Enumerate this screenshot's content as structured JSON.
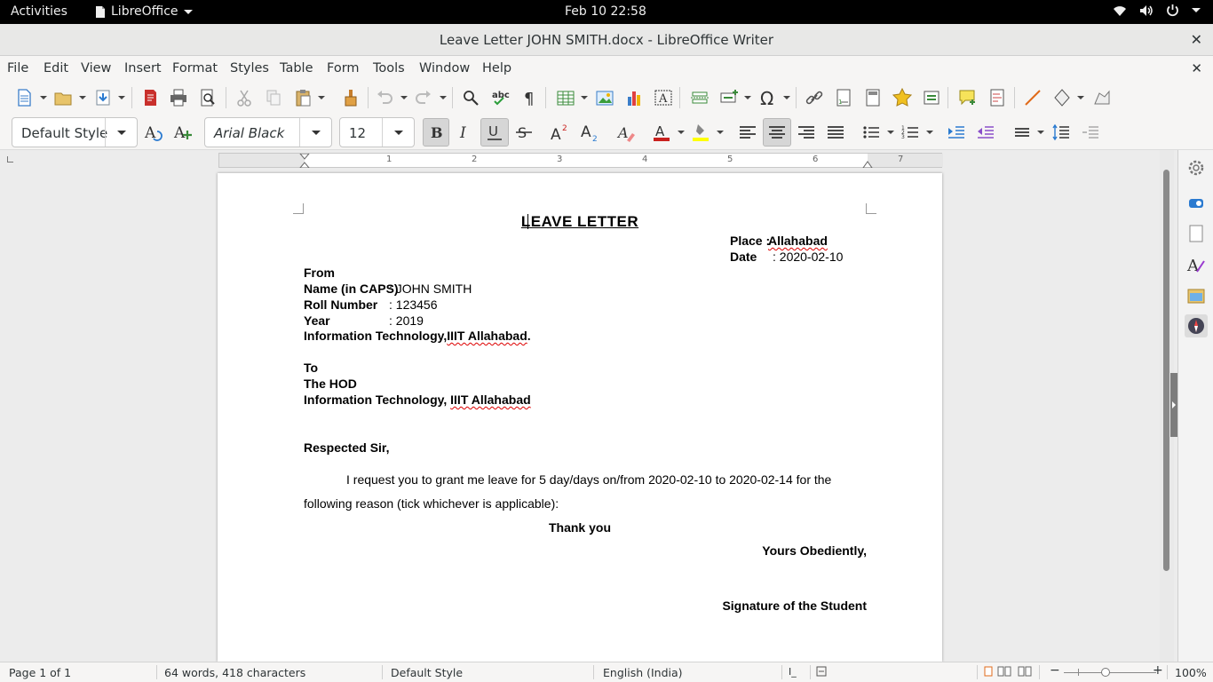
{
  "topbar": {
    "activities": "Activities",
    "app_name": "LibreOffice",
    "clock": "Feb 10  22:58"
  },
  "window": {
    "title": "Leave Letter JOHN SMITH.docx - LibreOffice Writer"
  },
  "menu": [
    "File",
    "Edit",
    "View",
    "Insert",
    "Format",
    "Styles",
    "Table",
    "Form",
    "Tools",
    "Window",
    "Help"
  ],
  "formatting": {
    "paragraph_style": "Default Style",
    "font_name": "Arial Black",
    "font_size": "12",
    "font_color": "#c9211e",
    "highlight_color": "#ffff00"
  },
  "ruler": {
    "numbers": [
      "1",
      "2",
      "3",
      "4",
      "5",
      "6",
      "7"
    ]
  },
  "document": {
    "heading": "LEAVE LETTER",
    "place_label": "Place :",
    "place_value": "Allahabad",
    "date_label": "Date",
    "date_value": ": 2020-02-10",
    "from": "From",
    "name_label": "Name (in CAPS)",
    "name_value": ": JOHN SMITH",
    "roll_label": "Roll Number",
    "roll_value": ": 123456",
    "year_label": "Year",
    "year_value": ": 2019",
    "from_dept_pre": "Information Technology,",
    "from_dept_inst": "IIIT Allahabad",
    "from_dept_post": ".",
    "to": "To",
    "hod": "The HOD",
    "to_dept_pre": "Information Technology, ",
    "to_dept_inst": "IIIT Allahabad",
    "salutation": "Respected Sir,",
    "body_line1": "I  request  you  to  grant  me  leave  for  5  day/days  on/from  2020-02-10  to  2020-02-14  for  the",
    "body_line2": "following reason (tick whichever is applicable):",
    "thanks": "Thank you",
    "closing": "Yours Obediently,",
    "signature": "Signature of the Student"
  },
  "statusbar": {
    "page": "Page 1 of 1",
    "words": "64 words, 418 characters",
    "page_style": "Default Style",
    "language": "English (India)",
    "zoom": "100%"
  }
}
